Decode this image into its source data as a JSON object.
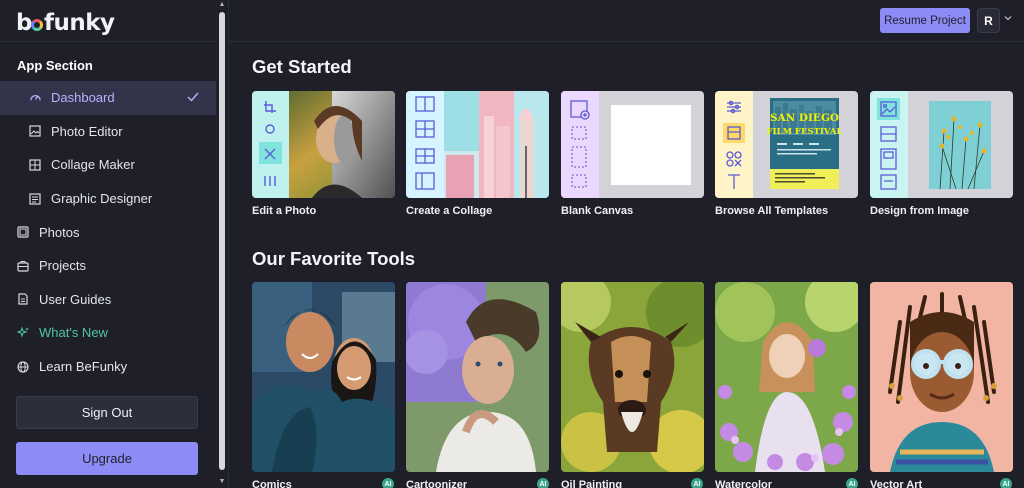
{
  "app": {
    "logo_text": "befunky"
  },
  "sidebar": {
    "section_title": "App Section",
    "items": [
      {
        "label": "Dashboard",
        "icon": "dashboard-icon",
        "active": true
      },
      {
        "label": "Photo Editor",
        "icon": "photo-editor-icon"
      },
      {
        "label": "Collage Maker",
        "icon": "collage-maker-icon"
      },
      {
        "label": "Graphic Designer",
        "icon": "graphic-designer-icon"
      }
    ],
    "top_items": [
      {
        "label": "Photos",
        "icon": "photos-icon"
      },
      {
        "label": "Projects",
        "icon": "projects-icon"
      },
      {
        "label": "User Guides",
        "icon": "user-guides-icon"
      },
      {
        "label": "What's New",
        "icon": "sparkle-icon"
      },
      {
        "label": "Learn BeFunky",
        "icon": "globe-icon"
      }
    ],
    "sign_out": "Sign Out",
    "upgrade": "Upgrade"
  },
  "header": {
    "resume_project": "Resume Project",
    "avatar_initial": "R"
  },
  "main": {
    "get_started_title": "Get Started",
    "get_started": [
      {
        "label": "Edit a Photo"
      },
      {
        "label": "Create a Collage"
      },
      {
        "label": "Blank Canvas"
      },
      {
        "label": "Browse All Templates",
        "poster_line1": "SAN DIEGO",
        "poster_line2": "FILM FESTIVAL"
      },
      {
        "label": "Design from Image"
      }
    ],
    "favorite_tools_title": "Our Favorite Tools",
    "favorite_tools": [
      {
        "label": "Comics",
        "badge": "AI"
      },
      {
        "label": "Cartoonizer",
        "badge": "AI"
      },
      {
        "label": "Oil Painting",
        "badge": "AI"
      },
      {
        "label": "Watercolor",
        "badge": "AI"
      },
      {
        "label": "Vector Art",
        "badge": "AI"
      }
    ]
  },
  "colors": {
    "background": "#1e1f29",
    "accent": "#8c8cf7",
    "active_item_bg": "#33344a",
    "whats_new": "#4fc6a0"
  }
}
